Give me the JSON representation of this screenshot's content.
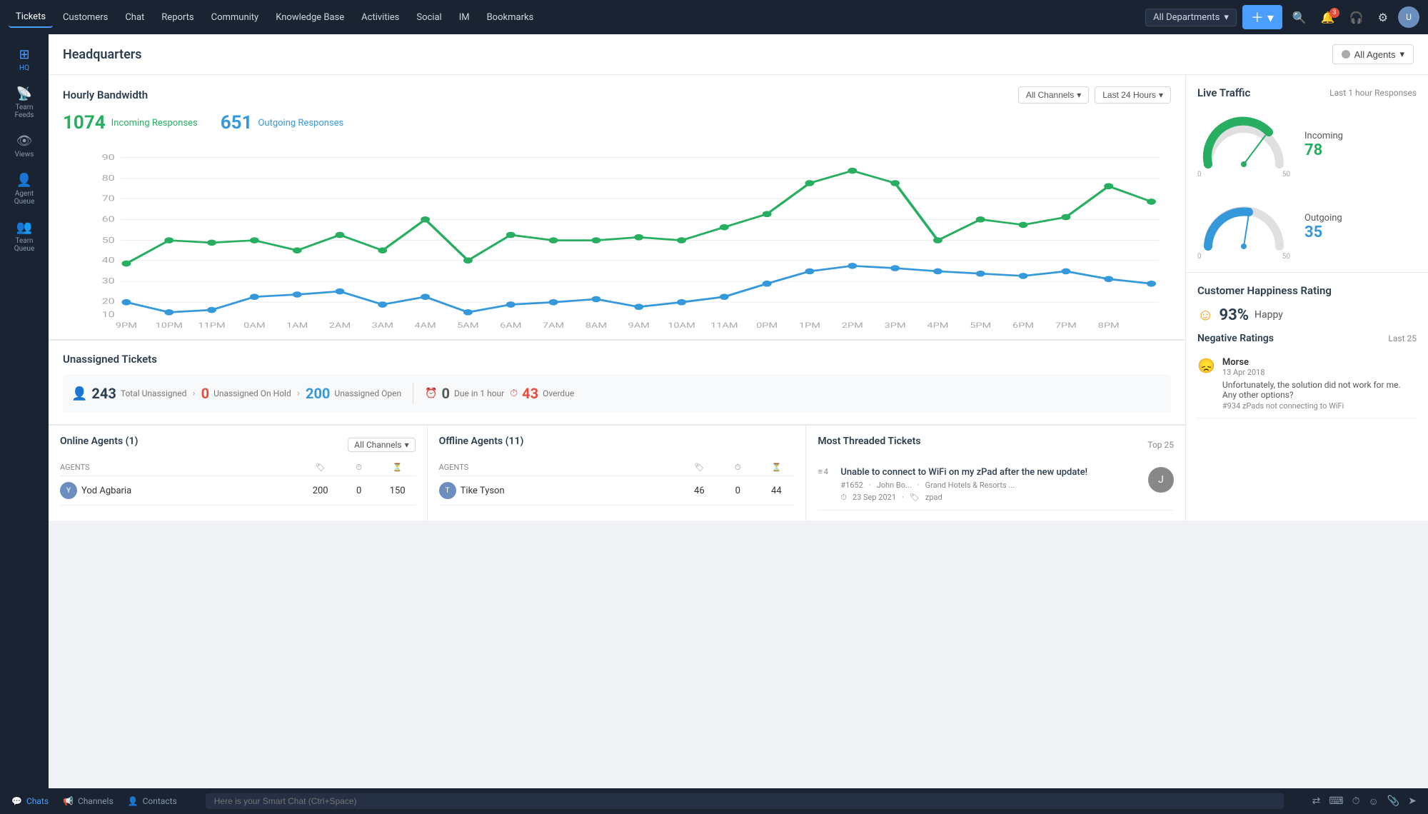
{
  "app": {
    "title": "Tickets"
  },
  "topnav": {
    "items": [
      {
        "label": "Tickets",
        "active": true
      },
      {
        "label": "Customers",
        "active": false
      },
      {
        "label": "Chat",
        "active": false
      },
      {
        "label": "Reports",
        "active": false
      },
      {
        "label": "Community",
        "active": false
      },
      {
        "label": "Knowledge Base",
        "active": false
      },
      {
        "label": "Activities",
        "active": false
      },
      {
        "label": "Social",
        "active": false
      },
      {
        "label": "IM",
        "active": false
      },
      {
        "label": "Bookmarks",
        "active": false
      }
    ],
    "department": "All Departments",
    "notifications_badge": "3"
  },
  "sidebar": {
    "items": [
      {
        "label": "HQ",
        "icon": "⊞",
        "active": false
      },
      {
        "label": "Team Feeds",
        "icon": "📡",
        "active": false
      },
      {
        "label": "Views",
        "icon": "👁",
        "active": false
      },
      {
        "label": "Agent Queue",
        "icon": "👤",
        "active": false
      },
      {
        "label": "Team Queue",
        "icon": "👥",
        "active": false
      }
    ],
    "bottom_items": [
      {
        "label": "⇒",
        "icon": "⇒"
      }
    ]
  },
  "page": {
    "title": "Headquarters",
    "all_agents_label": "All Agents"
  },
  "bandwidth": {
    "title": "Hourly Bandwidth",
    "incoming_count": "1074",
    "incoming_label": "Incoming Responses",
    "outgoing_count": "651",
    "outgoing_label": "Outgoing Responses",
    "filter_channels": "All Channels",
    "filter_time": "Last 24 Hours",
    "y_labels": [
      "90",
      "80",
      "70",
      "60",
      "50",
      "40",
      "30",
      "20",
      "10"
    ],
    "x_labels": [
      "9PM",
      "10PM",
      "11PM",
      "0AM",
      "1AM",
      "2AM",
      "3AM",
      "4AM",
      "5AM",
      "6AM",
      "7AM",
      "8AM",
      "9AM",
      "10AM",
      "11AM",
      "0PM",
      "1PM",
      "2PM",
      "3PM",
      "4PM",
      "5PM",
      "6PM",
      "7PM",
      "8PM"
    ]
  },
  "live_traffic": {
    "title": "Live Traffic",
    "subtitle": "Last 1 hour Responses",
    "incoming_label": "Incoming",
    "incoming_value": "78",
    "incoming_min": "0",
    "incoming_max": "50",
    "outgoing_label": "Outgoing",
    "outgoing_value": "35",
    "outgoing_min": "0",
    "outgoing_max": "50"
  },
  "unassigned": {
    "title": "Unassigned Tickets",
    "total_count": "243",
    "total_label": "Total Unassigned",
    "on_hold_count": "0",
    "on_hold_label": "Unassigned On Hold",
    "open_count": "200",
    "open_label": "Unassigned Open",
    "due_count": "0",
    "due_label": "Due in 1 hour",
    "overdue_count": "43",
    "overdue_label": "Overdue"
  },
  "online_agents": {
    "title": "Online Agents (1)",
    "filter": "All Channels",
    "columns": [
      "AGENTS",
      "",
      "",
      ""
    ],
    "agents": [
      {
        "name": "Yod Agbaria",
        "col1": "200",
        "col2": "0",
        "col3": "150"
      }
    ]
  },
  "offline_agents": {
    "title": "Offline Agents (11)",
    "agents": [
      {
        "name": "Tike Tyson",
        "col1": "46",
        "col2": "0",
        "col3": "44"
      }
    ]
  },
  "most_threaded": {
    "title": "Most Threaded Tickets",
    "top_label": "Top 25",
    "tickets": [
      {
        "count": "4",
        "title": "Unable to connect to WiFi on my zPad after the new update!",
        "ticket_id": "#1652",
        "customer": "John Bo...",
        "company": "Grand Hotels & Resorts ...",
        "date": "23 Sep 2021",
        "tag": "zpad"
      }
    ]
  },
  "happiness": {
    "title": "Customer Happiness Rating",
    "happy_percent": "93%",
    "happy_label": "Happy"
  },
  "negative_ratings": {
    "title": "Negative Ratings",
    "last_label": "Last 25",
    "items": [
      {
        "name": "Morse",
        "date": "13 Apr 2018",
        "text": "Unfortunately, the solution did not work for me. Any other options?",
        "ticket": "#934 zPads not connecting to WiFi"
      }
    ]
  },
  "bottom_bar": {
    "chat_placeholder": "Here is your Smart Chat (Ctrl+Space)",
    "items": [
      {
        "label": "Chats",
        "icon": "💬",
        "active": true
      },
      {
        "label": "Channels",
        "icon": "📢"
      },
      {
        "label": "Contacts",
        "icon": "👤"
      }
    ]
  }
}
